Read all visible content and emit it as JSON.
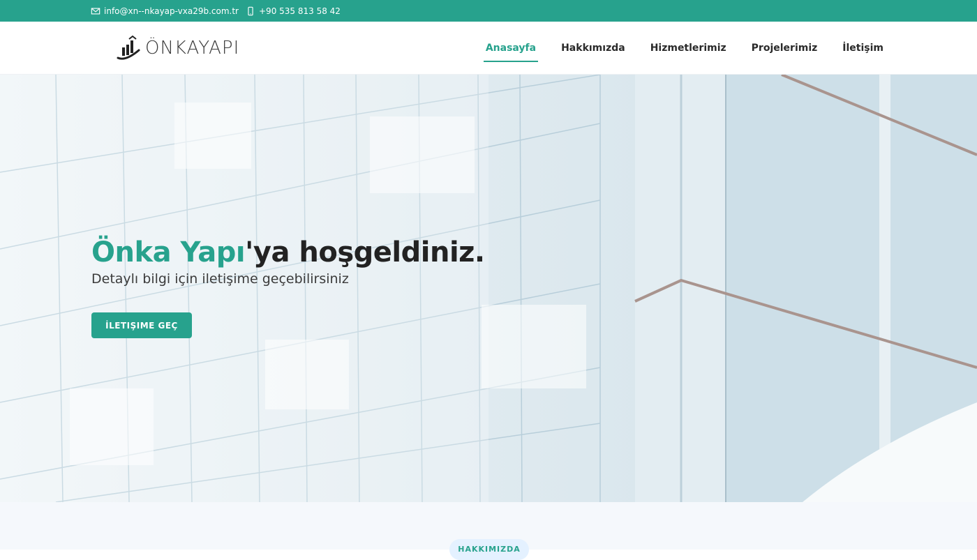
{
  "topbar": {
    "email": "info@xn--nkayap-vxa29b.com.tr",
    "phone": "+90 535 813 58 42",
    "email_icon": "envelope-icon",
    "phone_icon": "mobile-phone-icon"
  },
  "header": {
    "logo_text": "ÖNKAYAPI",
    "nav": [
      {
        "label": "Anasayfa",
        "active": true
      },
      {
        "label": "Hakkımızda",
        "active": false
      },
      {
        "label": "Hizmetlerimiz",
        "active": false
      },
      {
        "label": "Projelerimiz",
        "active": false
      },
      {
        "label": "İletişim",
        "active": false
      }
    ]
  },
  "hero": {
    "title_accent": "Önka Yapı",
    "title_rest": "'ya hoşgeldiniz.",
    "subtitle": "Detaylı bilgi için iletişime geçebilirsiniz",
    "cta_label": "İLETIŞIME GEÇ"
  },
  "about": {
    "section_tag": "HAKKIMIZDA"
  },
  "colors": {
    "accent": "#27a28d",
    "text_dark": "#222222",
    "section_bg": "#f5f8fc"
  }
}
